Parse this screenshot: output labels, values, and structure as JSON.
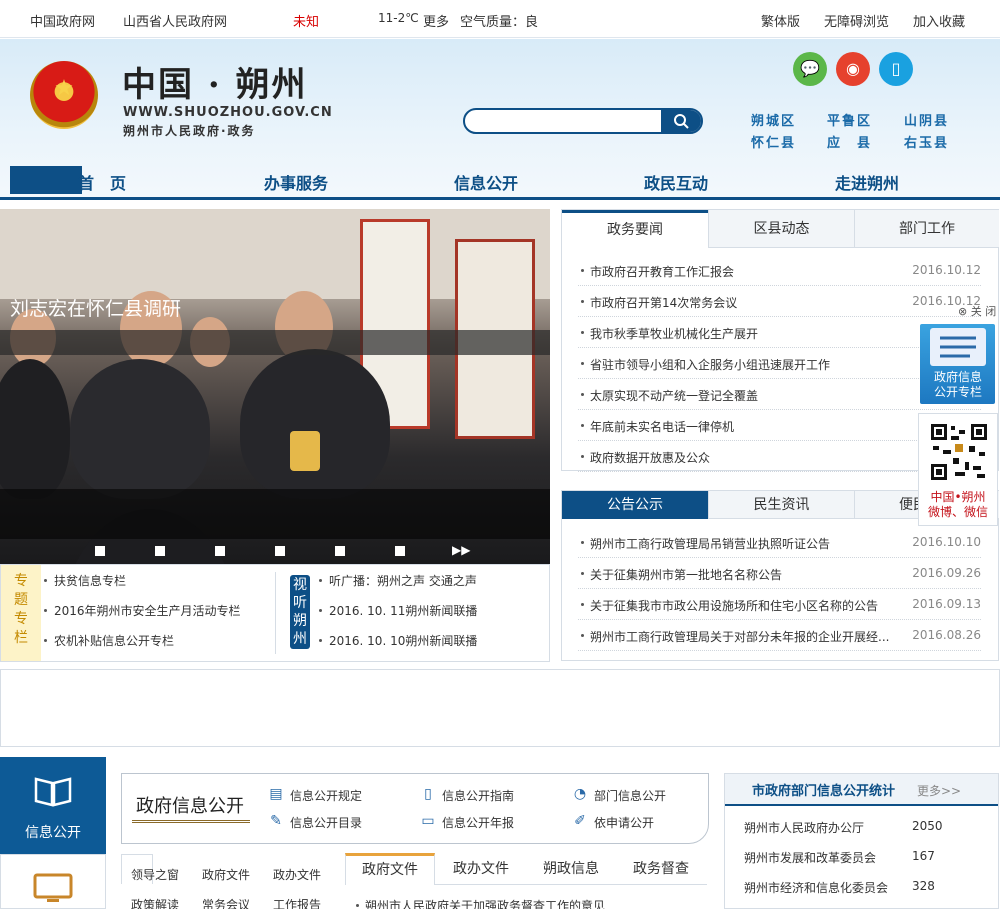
{
  "topbar": {
    "links": [
      "中国政府网",
      "山西省人民政府网"
    ],
    "weather_city": "未知",
    "temperature": "11-2℃",
    "more": "更多",
    "air_quality": "空气质量：良",
    "right_links": [
      "繁体版",
      "无障碍浏览",
      "加入收藏"
    ]
  },
  "header": {
    "site_name": "中国 · 朔州",
    "site_url": "WWW.SHUOZHOU.GOV.CN",
    "site_subtitle": "朔州市人民政府·政务",
    "search_placeholder": "",
    "counties": [
      "朔城区",
      "平鲁区",
      "山阴县",
      "怀仁县",
      "应　县",
      "右玉县"
    ]
  },
  "nav": [
    "首　页",
    "办事服务",
    "信息公开",
    "政民互动",
    "走进朔州"
  ],
  "slider": {
    "caption": "刘志宏在怀仁县调研",
    "next": "▶▶"
  },
  "topics": {
    "label": [
      "专",
      "题",
      "专",
      "栏"
    ],
    "items": [
      "扶贫信息专栏",
      "2016年朔州市安全生产月活动专栏",
      "农机补贴信息公开专栏"
    ],
    "shiting": [
      "视",
      "听",
      "朔",
      "州"
    ],
    "media": [
      "听广播：朔州之声 交通之声",
      "2016. 10. 11朔州新闻联播",
      "2016. 10. 10朔州新闻联播"
    ]
  },
  "news": {
    "tabs": [
      "政务要闻",
      "区县动态",
      "部门工作"
    ],
    "items": [
      {
        "title": "市政府召开教育工作汇报会",
        "date": "2016.10.12"
      },
      {
        "title": "市政府召开第14次常务会议",
        "date": "2016.10.12"
      },
      {
        "title": "我市秋季草牧业机械化生产展开",
        "date": ""
      },
      {
        "title": "省驻市领导小组和入企服务小组迅速展开工作",
        "date": ""
      },
      {
        "title": "太原实现不动产统一登记全覆盖",
        "date": ""
      },
      {
        "title": "年底前未实名电话一律停机",
        "date": ""
      },
      {
        "title": "政府数据开放惠及公众",
        "date": ""
      }
    ]
  },
  "notices": {
    "tabs": [
      "公告公示",
      "民生资讯",
      "便民"
    ],
    "items": [
      {
        "title": "朔州市工商行政管理局吊销营业执照听证公告",
        "date": "2016.10.10"
      },
      {
        "title": "关于征集朔州市第一批地名名称公告",
        "date": "2016.09.26"
      },
      {
        "title": "关于征集我市市政公用设施场所和住宅小区名称的公告",
        "date": "2016.09.13"
      },
      {
        "title": "朔州市工商行政管理局关于对部分未年报的企业开展经...",
        "date": "2016.08.26"
      }
    ]
  },
  "float": {
    "close": "⊗ 关 闭",
    "info_column": [
      "政府信息",
      "公开专栏"
    ],
    "social_label": [
      "中国•朔州",
      "微博、微信"
    ]
  },
  "bottom": {
    "side_label": "信息公开",
    "gov_info_title": "政府信息公开",
    "gov_links": [
      "信息公开规定",
      "信息公开指南",
      "部门信息公开",
      "信息公开目录",
      "信息公开年报",
      "依申请公开"
    ],
    "left_tabs": [
      "领导之窗",
      "政府文件",
      "政办文件",
      "政策解读",
      "常务会议",
      "工作报告"
    ],
    "doc_tabs": [
      "政府文件",
      "政办文件",
      "朔政信息",
      "政务督查"
    ],
    "first_doc": "朔州市人民政府关于加强政务督查工作的意见",
    "stats_title": "市政府部门信息公开统计",
    "stats_more": "更多>>",
    "stats": [
      {
        "name": "朔州市人民政府办公厅",
        "value": "2050"
      },
      {
        "name": "朔州市发展和改革委员会",
        "value": "167"
      },
      {
        "name": "朔州市经济和信息化委员会",
        "value": "328"
      }
    ]
  },
  "colors": {
    "primary": "#0d4f86",
    "accent": "#e8a33c",
    "alert": "#d80000"
  }
}
